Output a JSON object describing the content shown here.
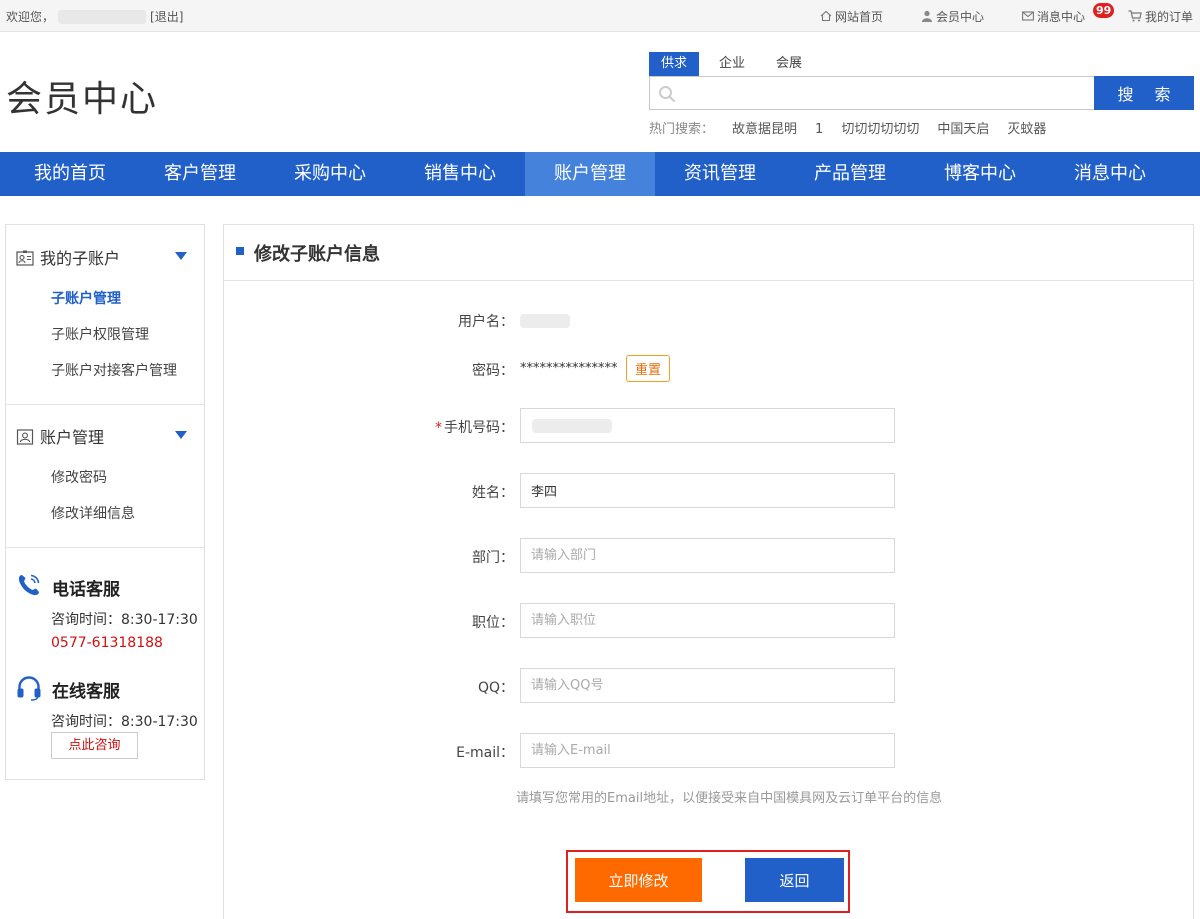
{
  "topbar": {
    "welcome": "欢迎您，",
    "logout": "[退出]",
    "links": [
      "网站首页",
      "会员中心",
      "消息中心",
      "我的订单"
    ],
    "message_badge": "99"
  },
  "header": {
    "logo": "会员中心",
    "search_tabs": [
      "供求",
      "企业",
      "会展"
    ],
    "search_button": "搜 索",
    "search_placeholder": "",
    "hot_label": "热门搜索：",
    "hot_keywords": [
      "故意据昆明",
      "1",
      "切切切切切切",
      "中国天启",
      "灭蚊器"
    ]
  },
  "nav": {
    "items": [
      "我的首页",
      "客户管理",
      "采购中心",
      "销售中心",
      "账户管理",
      "资讯管理",
      "产品管理",
      "博客中心",
      "消息中心"
    ],
    "active_index": 4
  },
  "sidebar": {
    "section1": {
      "title": "我的子账户",
      "links": [
        "子账户管理",
        "子账户权限管理",
        "子账户对接客户管理"
      ]
    },
    "section2": {
      "title": "账户管理",
      "links": [
        "修改密码",
        "修改详细信息"
      ]
    },
    "phone_service": {
      "title": "电话客服",
      "hours": "咨询时间：8:30-17:30",
      "phone": "0577-61318188"
    },
    "online_service": {
      "title": "在线客服",
      "hours": "咨询时间：8:30-17:30",
      "consult_button": "点此咨询"
    }
  },
  "main": {
    "title": "修改子账户信息",
    "form": {
      "username_label": "用户名：",
      "password_label": "密码：",
      "password_value": "***************",
      "reset_button": "重置",
      "phone_label": "手机号码：",
      "name_label": "姓名：",
      "name_value": "李四",
      "department_label": "部门：",
      "department_placeholder": "请输入部门",
      "position_label": "职位：",
      "position_placeholder": "请输入职位",
      "qq_label": "QQ：",
      "qq_placeholder": "请输入QQ号",
      "email_label": "E-mail：",
      "email_placeholder": "请输入E-mail",
      "email_hint": "请填写您常用的Email地址，以便接受来自中国模具网及云订单平台的信息"
    },
    "submit_button": "立即修改",
    "back_button": "返回"
  },
  "colors": {
    "primary_blue": "#2060c8",
    "nav_active": "#4582dc",
    "orange": "#ff6a00",
    "red": "#e02020"
  }
}
